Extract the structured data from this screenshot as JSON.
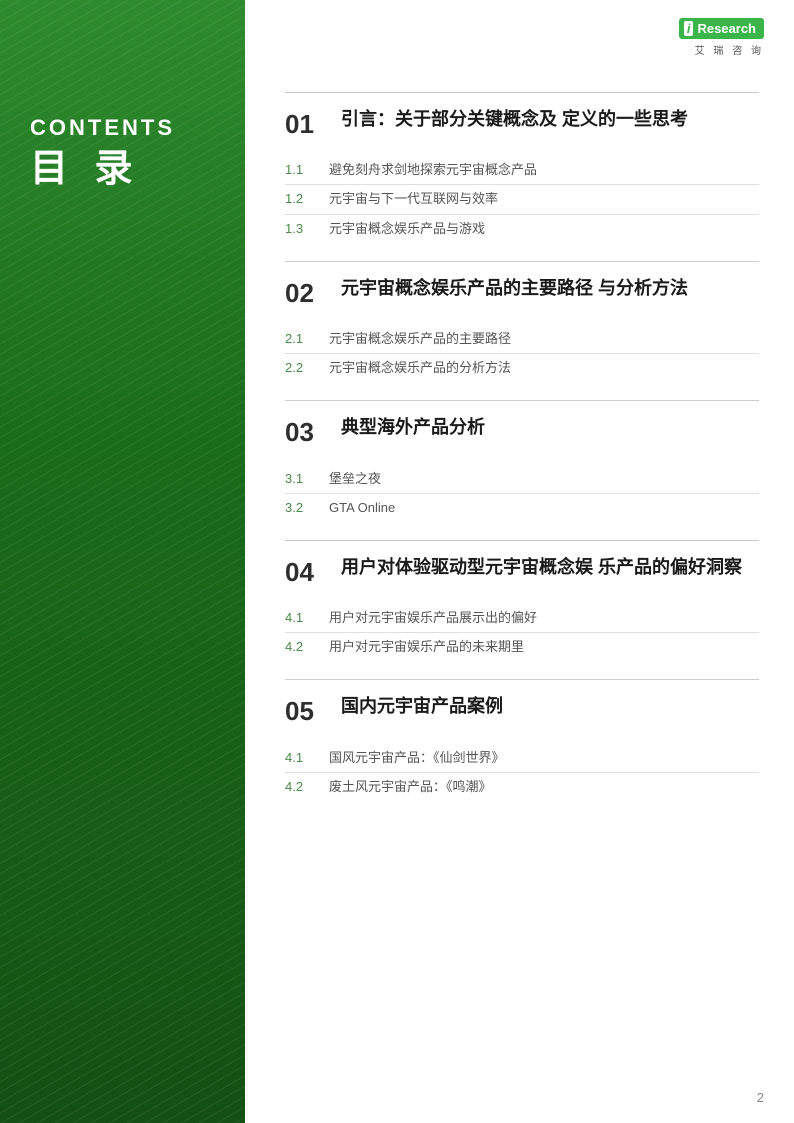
{
  "sidebar": {
    "contents_en": "CONTENTS",
    "contents_zh": "目 录"
  },
  "logo": {
    "i": "i",
    "brand": "Research",
    "subtitle": "艾 瑞 咨 询"
  },
  "toc": {
    "sections": [
      {
        "number": "01",
        "title": "引言：关于部分关键概念及\n定义的一些思考",
        "subs": [
          {
            "num": "1.1",
            "title": "避免刻舟求剑地探索元宇宙概念产品"
          },
          {
            "num": "1.2",
            "title": "元宇宙与下一代互联网与效率"
          },
          {
            "num": "1.3",
            "title": "元宇宙概念娱乐产品与游戏"
          }
        ]
      },
      {
        "number": "02",
        "title": "元宇宙概念娱乐产品的主要路径\n与分析方法",
        "subs": [
          {
            "num": "2.1",
            "title": "元宇宙概念娱乐产品的主要路径"
          },
          {
            "num": "2.2",
            "title": "元宇宙概念娱乐产品的分析方法"
          }
        ]
      },
      {
        "number": "03",
        "title": "典型海外产品分析",
        "subs": [
          {
            "num": "3.1",
            "title": "堡垒之夜"
          },
          {
            "num": "3.2",
            "title": "GTA Online"
          }
        ]
      },
      {
        "number": "04",
        "title": "用户对体验驱动型元宇宙概念娱\n乐产品的偏好洞察",
        "subs": [
          {
            "num": "4.1",
            "title": "用户对元宇宙娱乐产品展示出的偏好"
          },
          {
            "num": "4.2",
            "title": "用户对元宇宙娱乐产品的未来期里"
          }
        ]
      },
      {
        "number": "05",
        "title": "国内元宇宙产品案例",
        "subs": [
          {
            "num": "4.1",
            "title": "国风元宇宙产品：《仙剑世界》"
          },
          {
            "num": "4.2",
            "title": "废土风元宇宙产品：《鸣潮》"
          }
        ]
      }
    ]
  },
  "page_number": "2"
}
